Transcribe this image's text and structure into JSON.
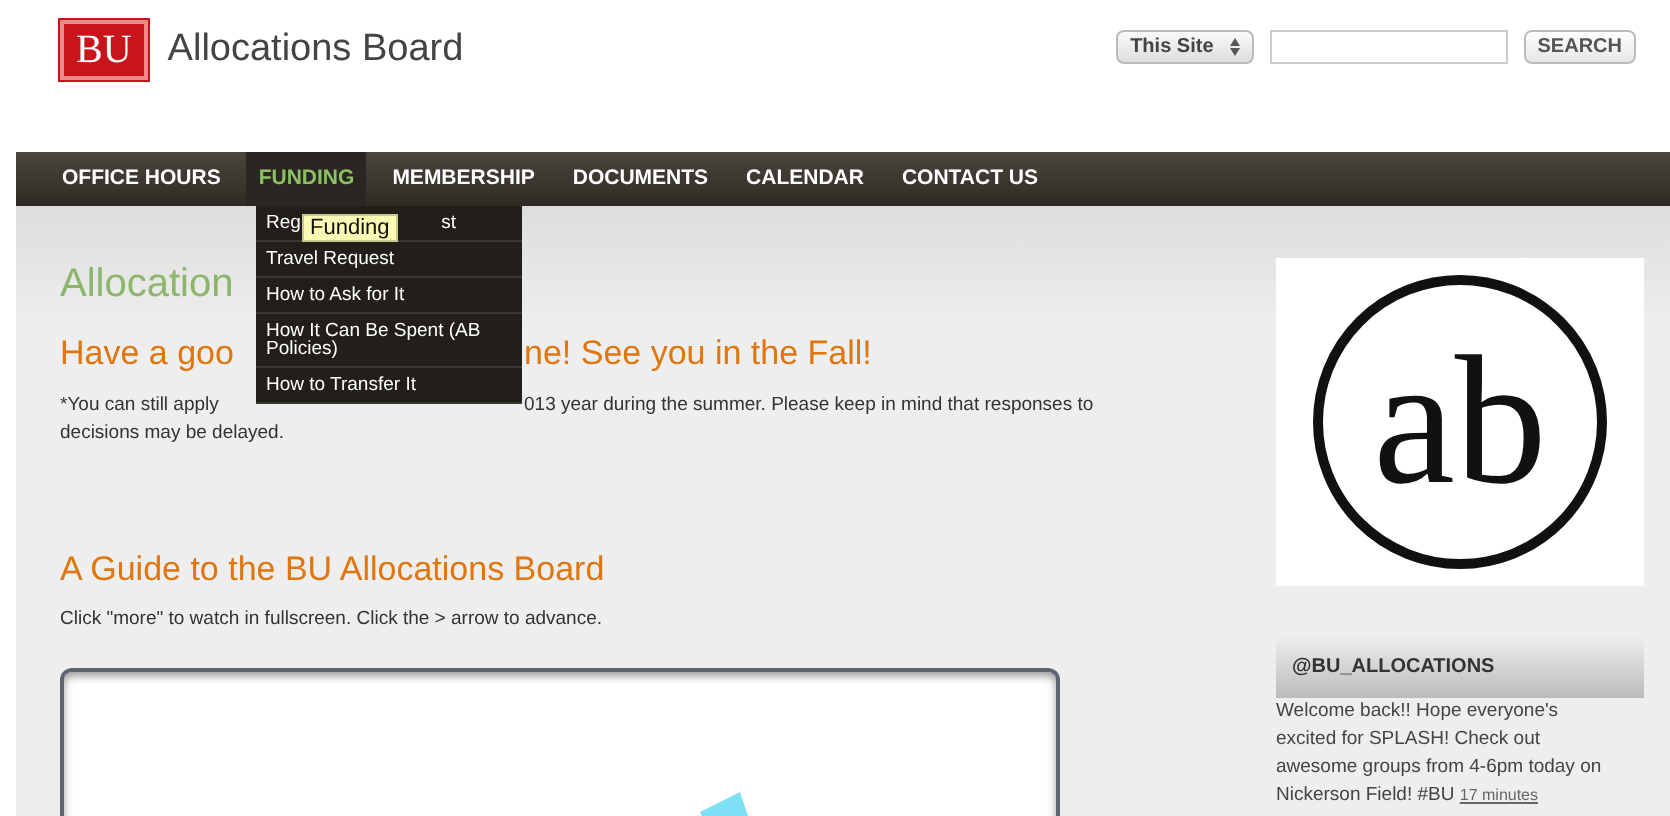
{
  "logo": {
    "mark": "BU",
    "title": "Allocations Board"
  },
  "search": {
    "scope": "This Site",
    "button": "SEARCH"
  },
  "nav": [
    {
      "label": "OFFICE HOURS",
      "selected": false
    },
    {
      "label": "FUNDING",
      "selected": true
    },
    {
      "label": "MEMBERSHIP",
      "selected": false
    },
    {
      "label": "DOCUMENTS",
      "selected": false
    },
    {
      "label": "CALENDAR",
      "selected": false
    },
    {
      "label": "CONTACT US",
      "selected": false
    }
  ],
  "dropdown": [
    {
      "parts": [
        "Reg",
        "st"
      ]
    },
    {
      "parts": [
        "Travel Request"
      ]
    },
    {
      "parts": [
        "How to Ask for It"
      ]
    },
    {
      "parts": [
        "How It Can Be Spent (AB Policies)"
      ]
    },
    {
      "parts": [
        "How to Transfer It"
      ]
    }
  ],
  "tooltip": "Funding",
  "main": {
    "page_title": [
      "Allocation"
    ],
    "notice": [
      "Have a goo",
      "ne! See you in the Fall!"
    ],
    "note_line1": [
      "*You can still apply",
      "013 year during the summer. Please keep in mind that responses to"
    ],
    "note_line2": "decisions may be delayed.",
    "guide_title": "A Guide to the BU Allocations Board",
    "guide_hint": "Click \"more\" to watch in fullscreen. Click the > arrow to advance."
  },
  "sidebar": {
    "logo_text": "ab",
    "twitter_handle": "@BU_ALLOCATIONS",
    "tweet": "Welcome back!! Hope everyone's excited for SPLASH! Check out awesome groups from 4-6pm today on Nickerson Field! #BU",
    "tweet_time": "17 minutes"
  }
}
